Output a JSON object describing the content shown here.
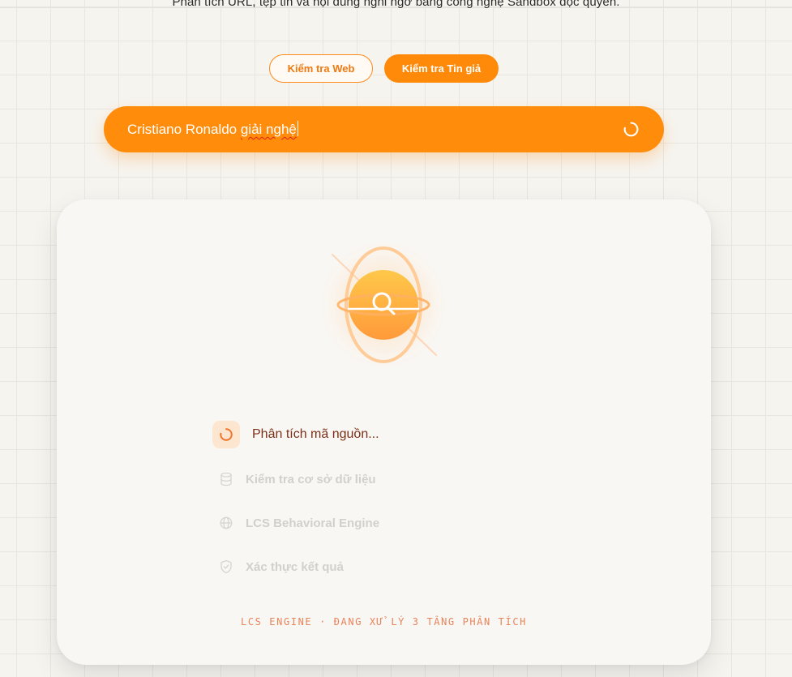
{
  "header": {
    "subtitle": "Phân tích URL, tệp tin và nội dung nghi ngờ bằng công nghệ Sandbox độc quyền."
  },
  "mode_tabs": [
    {
      "label": "Kiểm tra Web",
      "active": false
    },
    {
      "label": "Kiểm tra Tin giả",
      "active": true
    }
  ],
  "search": {
    "value_plain": "Cristiano Ronaldo ",
    "value_misspelled": "giải nghệ",
    "status_icon": "loading-spinner-icon"
  },
  "analysis": {
    "orb_icon": "search-icon",
    "steps": [
      {
        "label": "Phân tích mã nguồn...",
        "icon": "spinner-icon",
        "state": "active"
      },
      {
        "label": "Kiểm tra cơ sở dữ liệu",
        "icon": "database-icon",
        "state": "pending"
      },
      {
        "label": "LCS Behavioral Engine",
        "icon": "globe-icon",
        "state": "pending"
      },
      {
        "label": "Xác thực kết quả",
        "icon": "shield-check-icon",
        "state": "pending"
      }
    ],
    "footer": "LCS ENGINE · ĐANG XỬ LÝ 3 TẦNG PHÂN TÍCH"
  },
  "colors": {
    "accent": "#ff8c0a",
    "background": "#f6f4ef",
    "card": "#f9f7f4",
    "active_step_text": "#7a3018",
    "pending_step_text": "#d3d0cb",
    "footer_text": "#e8845a"
  }
}
